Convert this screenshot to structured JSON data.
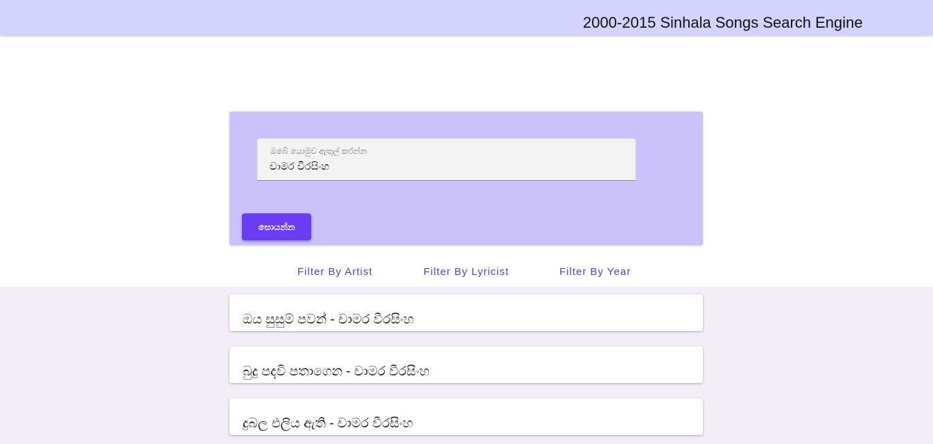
{
  "header": {
    "title": "2000-2015 Sinhala Songs Search Engine"
  },
  "search": {
    "label": "ඔබේ යොමුව ඇතුල් කරන්න",
    "value": "චාමර වීරසිංහ",
    "button_label": "සොයන්න"
  },
  "filters": {
    "artist_label": "Filter By Artist",
    "lyricist_label": "Filter By Lyricist",
    "year_label": "Filter By Year"
  },
  "results": [
    {
      "title": "ඔය සුසුම් පවන් - චාමර වීරසිංහ"
    },
    {
      "title": "බුදු පදවි පතාගෙන - චාමර වීරසිංහ"
    },
    {
      "title": "දුබල එලිය ඇති - චාමර වීරසිංහ"
    }
  ],
  "colors": {
    "header_bg": "#d3d3fd",
    "search_card_bg": "#cbc2fb",
    "button_bg": "#6a3cf4",
    "filter_text": "#5f3cc4",
    "results_bg": "#f3edf8"
  }
}
